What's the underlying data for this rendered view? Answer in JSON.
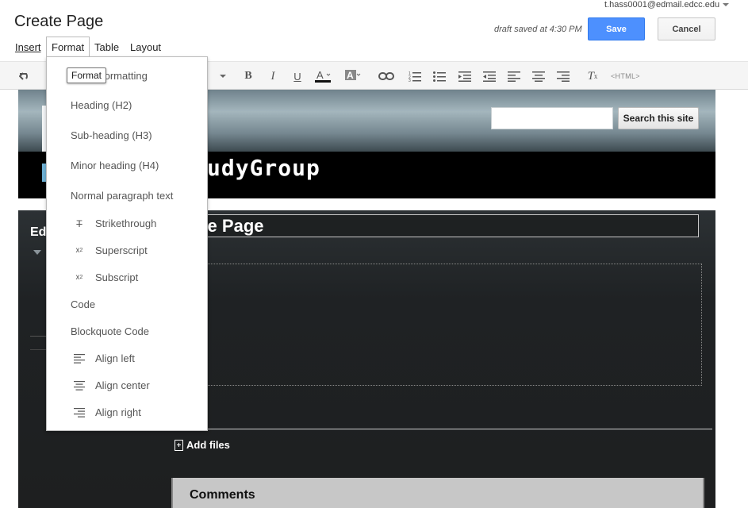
{
  "editor": {
    "title": "Create Page",
    "user_email": "t.hass0001@edmail.edcc.edu",
    "draft_status": "draft saved at 4:30 PM",
    "save_label": "Save",
    "cancel_label": "Cancel"
  },
  "menubar": {
    "insert": "Insert",
    "format": "Format",
    "table": "Table",
    "layout": "Layout"
  },
  "toolbar": {
    "html_label": "<HTML>"
  },
  "format_menu": {
    "tooltip": "Format",
    "items": [
      "Clear Formatting",
      "Heading (H2)",
      "Sub-heading (H3)",
      "Minor heading (H4)",
      "Normal paragraph text",
      "Strikethrough",
      "Superscript",
      "Subscript",
      "Code",
      "Blockquote Code",
      "Align left",
      "Align center",
      "Align right"
    ],
    "visible_clear_formatting_fragment": "ar Formatting"
  },
  "site": {
    "search_button": "Search this site",
    "title_fragment": "udyGroup",
    "sidebar_title_fragment": "Ed",
    "page_title_fragment": "ate Page",
    "add_files": "Add files",
    "comments_title": "Comments"
  },
  "colors": {
    "save_blue": "#4d90fe",
    "header_black": "#000000",
    "page_dark": "#1e1f20",
    "comments_gray": "#c7c7c7"
  }
}
